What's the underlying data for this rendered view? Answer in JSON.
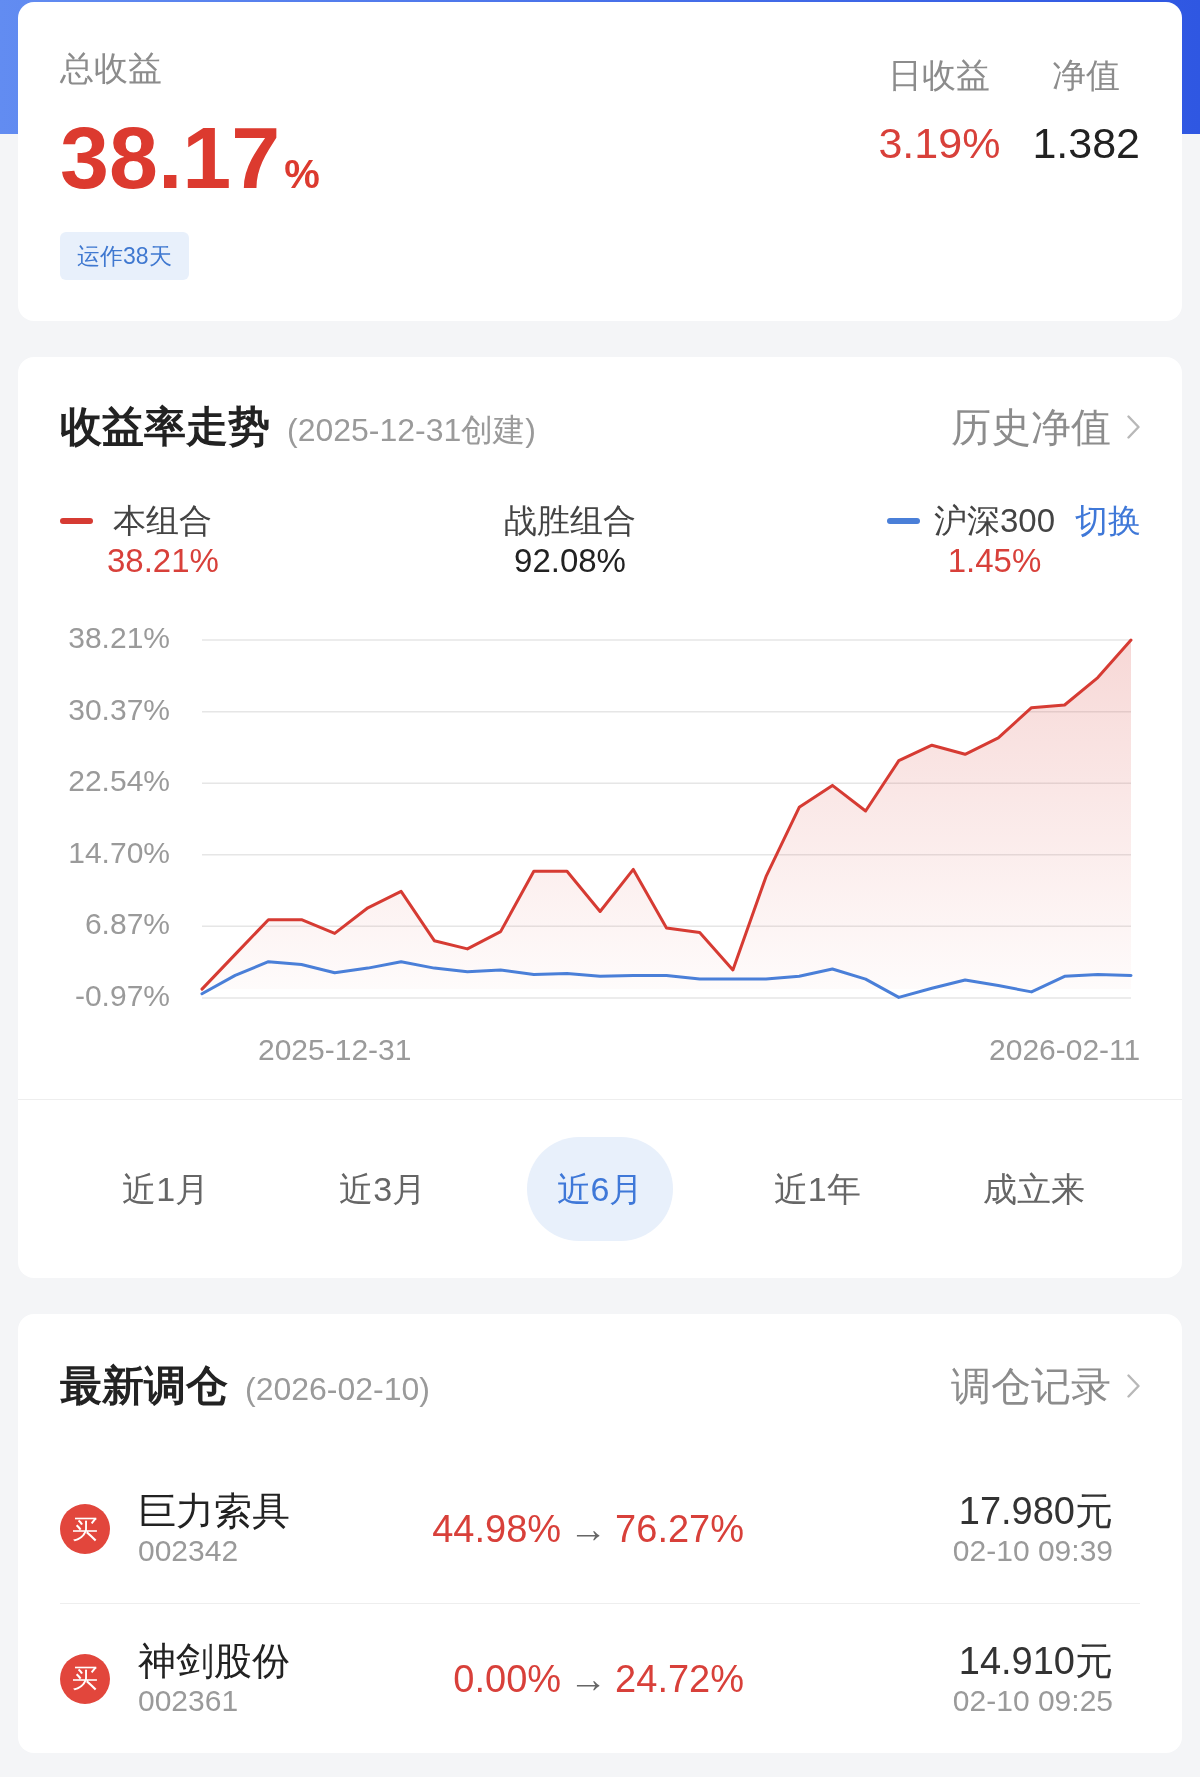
{
  "summary": {
    "label": "总收益",
    "value": "38.17",
    "unit": "%",
    "badge": "运作38天",
    "stats": [
      {
        "kind": "change",
        "label": "日收益",
        "value": "3.19%"
      },
      {
        "kind": "value",
        "label": "净值",
        "value": "1.382"
      }
    ]
  },
  "chart": {
    "title": "收益率走势",
    "subtitle": "(2025-12-31创建)",
    "link": "历史净值",
    "legend": [
      {
        "kind": "series",
        "label": "本组合",
        "value": "38.21%",
        "color": "#d63b33"
      },
      {
        "kind": "stat",
        "label": "战胜组合",
        "value": "92.08%"
      },
      {
        "kind": "series",
        "label": "沪深300",
        "value": "1.45%",
        "color": "#4a7fd8",
        "action": "切换"
      }
    ],
    "chart_data": {
      "type": "line",
      "grid": true,
      "categories": [
        null,
        null,
        null,
        null,
        "2025-12-31",
        null,
        null,
        null,
        null,
        null,
        null,
        null,
        null,
        null,
        null,
        null,
        null,
        null,
        null,
        null,
        null,
        null,
        null,
        null,
        null,
        null,
        "2026-02-11",
        null,
        null
      ],
      "ylim": [
        -0.97,
        38.21
      ],
      "yticks": [
        {
          "value": 38.21,
          "label": "38.21%"
        },
        {
          "value": 30.37,
          "label": "30.37%"
        },
        {
          "value": 22.54,
          "label": "22.54%"
        },
        {
          "value": 14.7,
          "label": "14.70%"
        },
        {
          "value": 6.87,
          "label": "6.87%"
        },
        {
          "value": -0.97,
          "label": "-0.97%"
        }
      ],
      "series": [
        {
          "type": "area",
          "color": "#d63b33",
          "values": [
            0,
            3.8,
            7.6,
            7.6,
            6.1,
            8.9,
            10.7,
            5.3,
            4.4,
            6.3,
            12.9,
            12.9,
            8.5,
            13.1,
            6.7,
            6.2,
            2.1,
            12.3,
            19.9,
            22.3,
            19.5,
            25,
            26.7,
            25.7,
            27.5,
            30.8,
            31.1,
            34.1,
            38.2
          ]
        },
        {
          "color": "#4a7fd8",
          "values": [
            -0.5,
            1.5,
            3,
            2.7,
            1.8,
            2.3,
            3,
            2.3,
            1.9,
            2.1,
            1.6,
            1.7,
            1.4,
            1.5,
            1.5,
            1.1,
            1.1,
            1.1,
            1.4,
            2.2,
            1.1,
            -0.9,
            0.1,
            1,
            0.4,
            -0.3,
            1.4,
            1.6,
            1.5
          ]
        }
      ]
    },
    "periods": [
      {
        "label": "近1月",
        "selected": false
      },
      {
        "label": "近3月",
        "selected": false
      },
      {
        "label": "近6月",
        "selected": true
      },
      {
        "label": "近1年",
        "selected": false
      },
      {
        "label": "成立来",
        "selected": false
      }
    ]
  },
  "rebalance": {
    "title": "最新调仓",
    "date": "(2026-02-10)",
    "link": "调仓记录",
    "trades": [
      {
        "kind": "buy",
        "side": "买",
        "name": "巨力索具",
        "code": "002342",
        "from": "44.98%",
        "arrow": "→",
        "to": "76.27%",
        "price": "17.980元",
        "time": "02-10 09:39"
      },
      {
        "kind": "buy",
        "side": "买",
        "name": "神剑股份",
        "code": "002361",
        "from": "0.00%",
        "arrow": "→",
        "to": "24.72%",
        "price": "14.910元",
        "time": "02-10 09:25"
      }
    ]
  }
}
